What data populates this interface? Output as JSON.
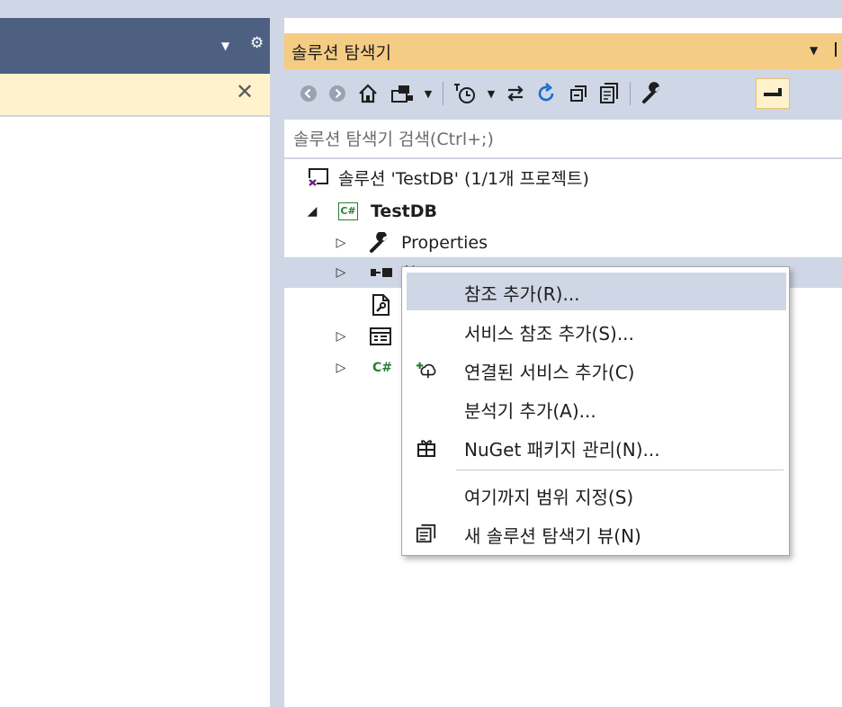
{
  "solution_explorer": {
    "title": "솔루션 탐색기",
    "search_placeholder": "솔루션 탐색기 검색(Ctrl+;)"
  },
  "tree": {
    "solution_label": "솔루션 'TestDB' (1/1개 프로젝트)",
    "project_label": "TestDB",
    "properties_label": "Properties",
    "references_partial": "참"
  },
  "context_menu": {
    "items": [
      {
        "label": "참조 추가(R)...",
        "icon": "none",
        "highlighted": true
      },
      {
        "label": "서비스 참조 추가(S)...",
        "icon": "none"
      },
      {
        "label": "연결된 서비스 추가(C)",
        "icon": "connected-service-icon"
      },
      {
        "label": "분석기 추가(A)...",
        "icon": "none"
      },
      {
        "label": "NuGet 패키지 관리(N)...",
        "icon": "nuget-package-icon"
      },
      {
        "label": "여기까지 범위 지정(S)",
        "icon": "none"
      },
      {
        "label": "새 솔루션 탐색기 뷰(N)",
        "icon": "new-explorer-view-icon"
      }
    ]
  },
  "colors": {
    "title_active": "#f5cc84",
    "toolbar_bg": "#cfd6e5",
    "left_title": "#4d6082",
    "selection": "#cfd6e5",
    "cs_green": "#2e7d32",
    "refresh_blue": "#1b6fc9"
  }
}
